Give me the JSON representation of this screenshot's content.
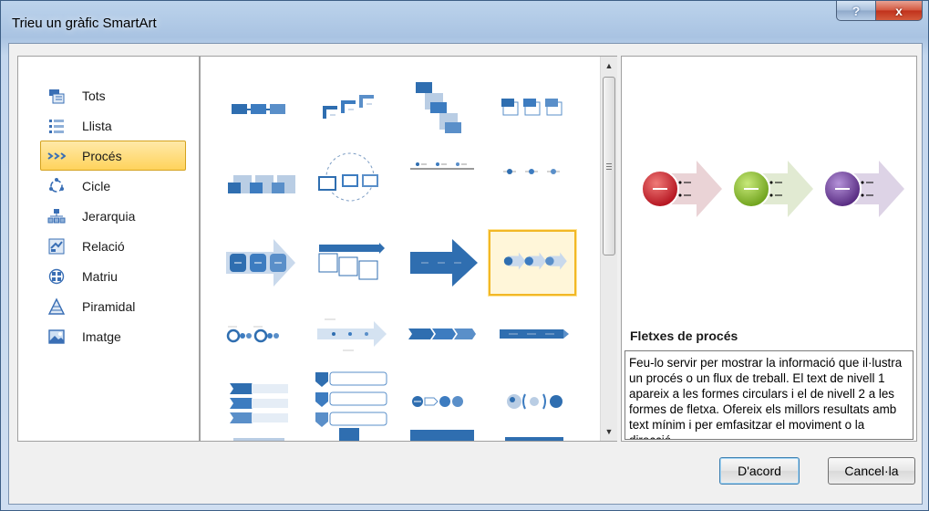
{
  "window": {
    "title": "Trieu un gràfic SmartArt",
    "help_label": "?",
    "close_label": "x"
  },
  "categories": [
    {
      "label": "Tots",
      "icon": "all-icon"
    },
    {
      "label": "Llista",
      "icon": "list-icon"
    },
    {
      "label": "Procés",
      "icon": "process-icon",
      "selected": true
    },
    {
      "label": "Cicle",
      "icon": "cycle-icon"
    },
    {
      "label": "Jerarquia",
      "icon": "hierarchy-icon"
    },
    {
      "label": "Relació",
      "icon": "relationship-icon"
    },
    {
      "label": "Matriu",
      "icon": "matrix-icon"
    },
    {
      "label": "Piramidal",
      "icon": "pyramid-icon"
    },
    {
      "label": "Imatge",
      "icon": "picture-icon"
    }
  ],
  "gallery": {
    "selected_index": 11,
    "layout_count": 24
  },
  "preview": {
    "title": "Fletxes de procés",
    "description": "Feu-lo servir per mostrar la informació que il·lustra un procés o un flux de treball. El text de nivell 1 apareix a les formes circulars i el de nivell 2 a les formes de fletxa. Ofereix els millors resultats amb text mínim i per emfasitzar el moviment o la direcció.",
    "colors": {
      "red": "#c4202b",
      "green": "#86bc26",
      "purple": "#6c3f97",
      "arrow": "#ebd6da"
    }
  },
  "buttons": {
    "ok_label": "D'acord",
    "cancel_label": "Cancel·la"
  },
  "colors": {
    "accent": "#f2b826",
    "shape_blue": "#2f6eb0",
    "shape_light": "#b9cde4"
  }
}
